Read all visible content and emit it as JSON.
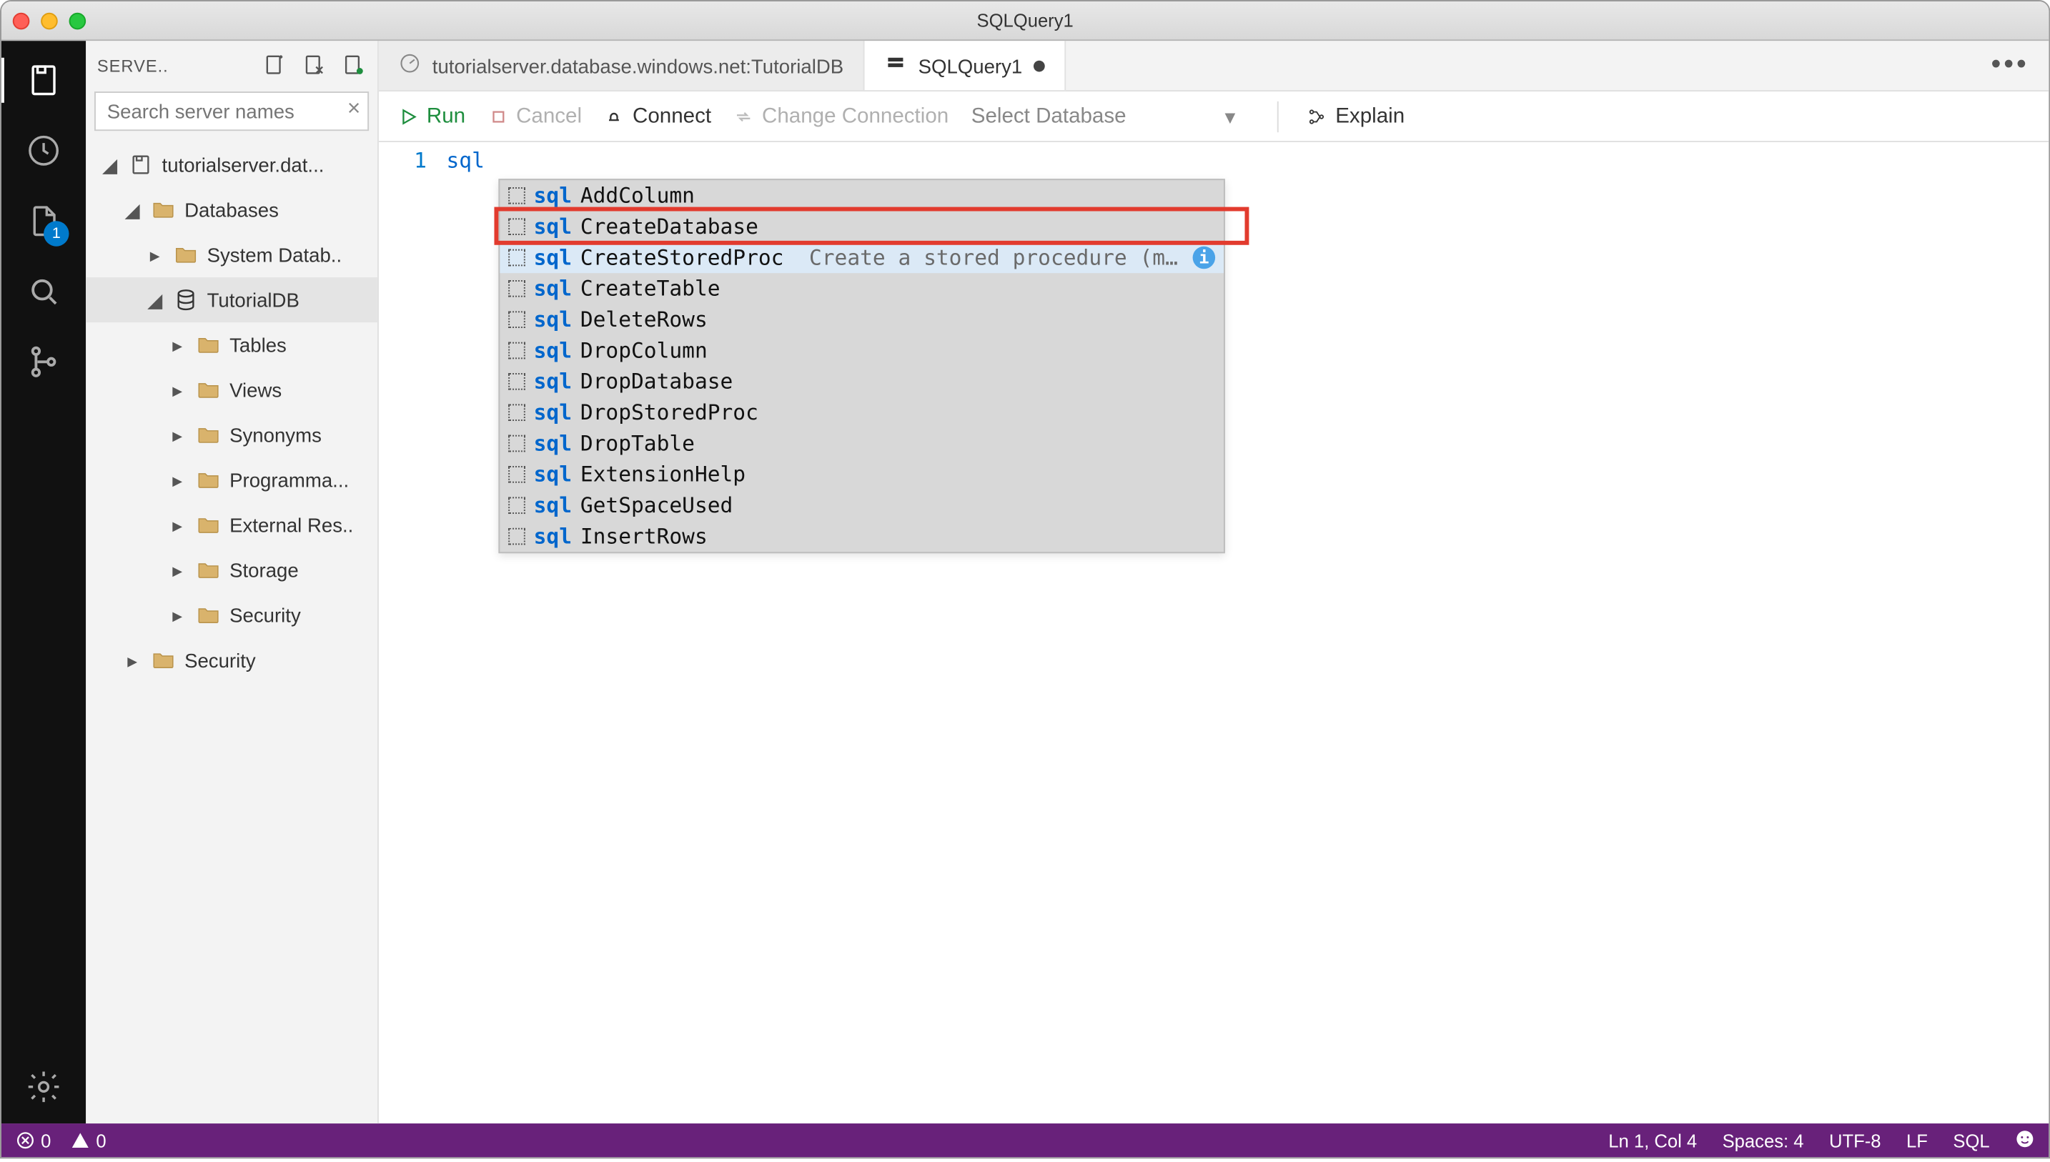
{
  "title": "SQLQuery1",
  "activity_badge": "1",
  "sidebar": {
    "header": "SERVE..",
    "search_placeholder": "Search server names",
    "tree": {
      "server": "tutorialserver.dat...",
      "databases_label": "Databases",
      "system_db": "System Datab..",
      "tutorialdb": "TutorialDB",
      "children": {
        "tables": "Tables",
        "views": "Views",
        "synonyms": "Synonyms",
        "programmability": "Programma...",
        "external": "External Res..",
        "storage": "Storage",
        "security_inner": "Security"
      },
      "security_outer": "Security"
    }
  },
  "tabs": {
    "conn": "tutorialserver.database.windows.net:TutorialDB",
    "query": "SQLQuery1"
  },
  "toolbar": {
    "run": "Run",
    "cancel": "Cancel",
    "connect": "Connect",
    "change": "Change Connection",
    "select_db": "Select Database",
    "explain": "Explain"
  },
  "editor": {
    "line_no": "1",
    "typed_prefix": "sql"
  },
  "suggest": {
    "match": "sql",
    "items": [
      {
        "rest": "AddColumn"
      },
      {
        "rest": "CreateDatabase"
      },
      {
        "rest": "CreateStoredProc",
        "desc": "Create a stored procedure (mssq…",
        "selected": true,
        "info": true
      },
      {
        "rest": "CreateTable"
      },
      {
        "rest": "DeleteRows"
      },
      {
        "rest": "DropColumn"
      },
      {
        "rest": "DropDatabase"
      },
      {
        "rest": "DropStoredProc"
      },
      {
        "rest": "DropTable"
      },
      {
        "rest": "ExtensionHelp"
      },
      {
        "rest": "GetSpaceUsed"
      },
      {
        "rest": "InsertRows"
      }
    ]
  },
  "status": {
    "errors": "0",
    "warnings": "0",
    "pos": "Ln 1, Col 4",
    "spaces": "Spaces: 4",
    "enc": "UTF-8",
    "eol": "LF",
    "lang": "SQL"
  }
}
